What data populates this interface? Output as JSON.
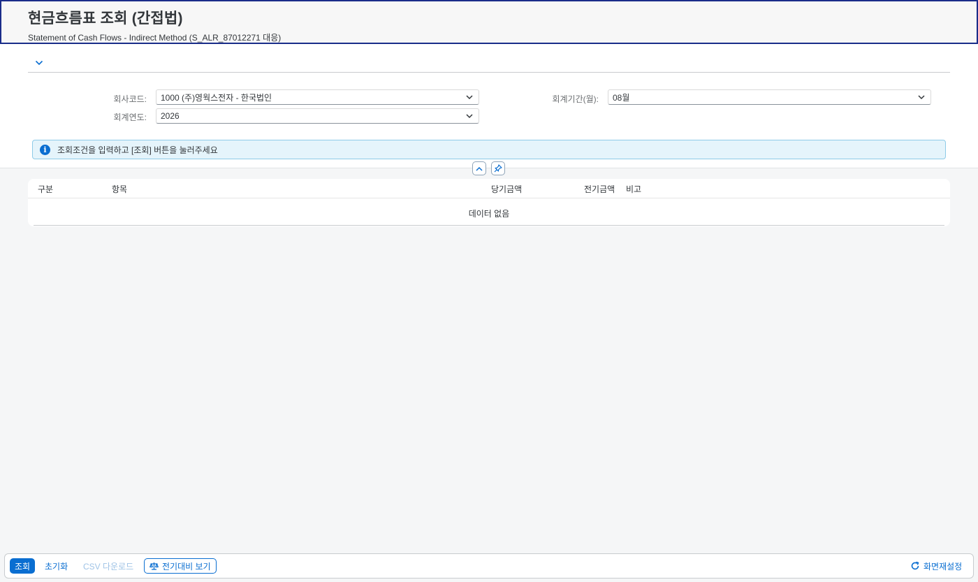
{
  "header": {
    "title": "현금흐름표 조회 (간접법)",
    "subtitle": "Statement of Cash Flows - Indirect Method (S_ALR_87012271 대응)"
  },
  "filters": {
    "company_code": {
      "label": "회사코드:",
      "value": "1000 (주)영웍스전자 - 한국법인"
    },
    "fiscal_year": {
      "label": "회계연도:",
      "value": "2026"
    },
    "period": {
      "label": "회계기간(월):",
      "value": "08월"
    }
  },
  "info_message": "조회조건을 입력하고 [조회] 버튼을 눌러주세요",
  "table": {
    "columns": [
      "구분",
      "항목",
      "당기금액",
      "전기금액",
      "비고"
    ],
    "no_data": "데이터 없음"
  },
  "footer": {
    "search": "조회",
    "reset": "초기화",
    "csv": "CSV 다운로드",
    "compare": "전기대비 보기",
    "reset_layout": "화면재설정"
  },
  "colors": {
    "accent": "#0a6ed1",
    "header_border": "#1a2d8a",
    "info_bg": "#e5f4fb"
  },
  "icons": {
    "expander": "chevron-down-icon",
    "info": "info-icon",
    "collapse": "chevron-up-icon",
    "pin": "pin-icon",
    "compare": "scale-icon",
    "refresh": "refresh-icon"
  }
}
